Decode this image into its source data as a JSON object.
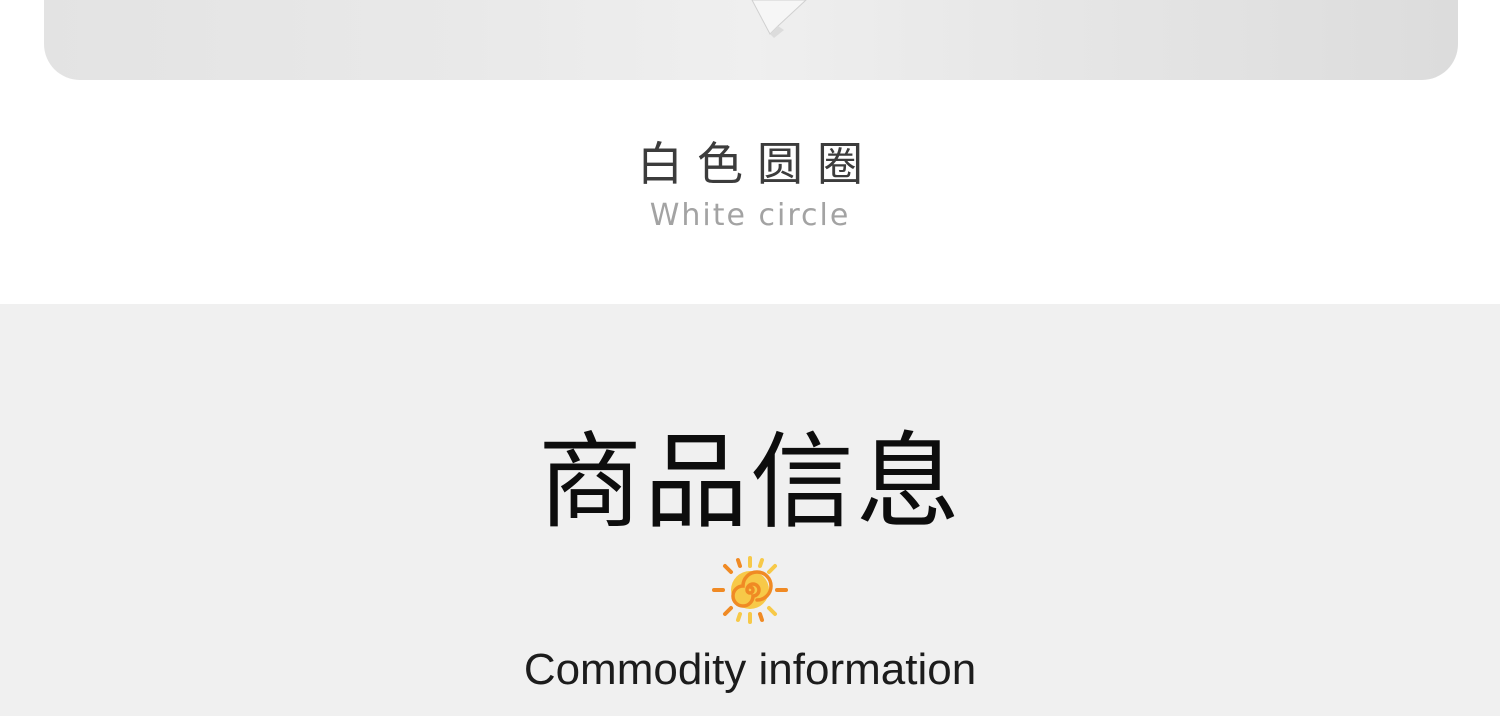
{
  "variant": {
    "title": "白色圆圈",
    "subtitle": "White circle"
  },
  "info": {
    "title": "商品信息",
    "subtitle": "Commodity information",
    "icon": "sun-icon"
  },
  "colors": {
    "page_background": "#ffffff",
    "info_background": "#f0f0f0",
    "sun_orange": "#f08a24",
    "sun_yellow": "#f7c948"
  }
}
